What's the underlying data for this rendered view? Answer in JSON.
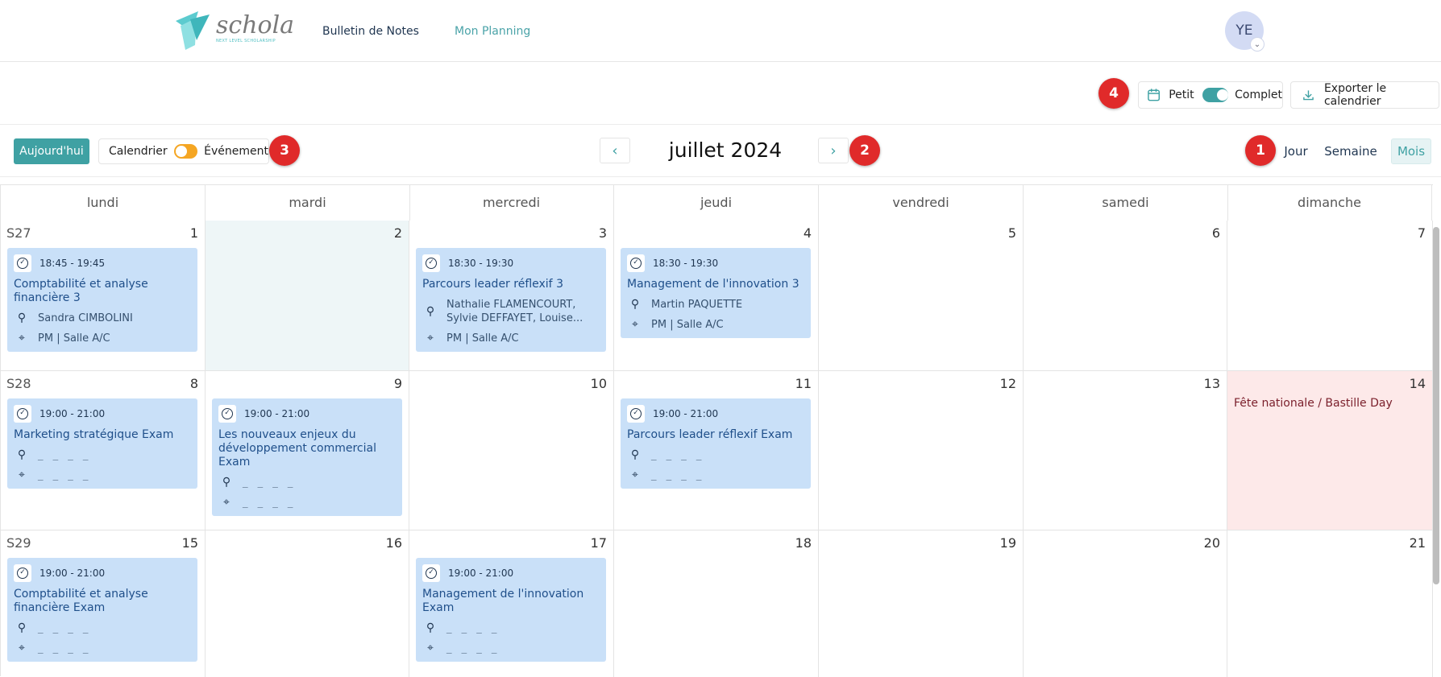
{
  "header": {
    "logo": {
      "text": "schola",
      "tagline": "NEXT LEVEL SCHOLARSHIP"
    },
    "nav": [
      {
        "label": "Bulletin de Notes",
        "active": false
      },
      {
        "label": "Mon Planning",
        "active": true
      }
    ],
    "avatar_initials": "YE",
    "avatar_chevron": "⌄"
  },
  "display": {
    "badge": "4",
    "size_small": "Petit",
    "size_full": "Complet",
    "size_toggle_on": true,
    "export_label": "Exporter le calendrier"
  },
  "toolbar": {
    "today_label": "Aujourd'hui",
    "mode_calendar": "Calendrier",
    "mode_event": "Événement",
    "mode_badge": "3",
    "prev_arrow": "‹",
    "next_arrow": "›",
    "nav_badge": "2",
    "month_title": "juillet 2024",
    "view_badge": "1",
    "views": [
      {
        "label": "Jour",
        "active": false
      },
      {
        "label": "Semaine",
        "active": false
      },
      {
        "label": "Mois",
        "active": true
      }
    ]
  },
  "calendar": {
    "weekdays": [
      "lundi",
      "mardi",
      "mercredi",
      "jeudi",
      "vendredi",
      "samedi",
      "dimanche"
    ],
    "weeks": [
      {
        "label": "S27",
        "days": [
          "1",
          "2",
          "3",
          "4",
          "5",
          "6",
          "7"
        ]
      },
      {
        "label": "S28",
        "days": [
          "8",
          "9",
          "10",
          "11",
          "12",
          "13",
          "14"
        ]
      },
      {
        "label": "S29",
        "days": [
          "15",
          "16",
          "17",
          "18",
          "19",
          "20",
          "21"
        ]
      }
    ],
    "holiday": "Fête nationale / Bastille Day",
    "placeholder": "_ _ _ _",
    "events": [
      {
        "time": "18:45 - 19:45",
        "title": "Comptabilité et analyse financière 3",
        "person": "Sandra CIMBOLINI",
        "location": "PM | Salle A/C"
      },
      {
        "time": "18:30 - 19:30",
        "title": "Parcours leader réflexif 3",
        "person": "Nathalie FLAMENCOURT, Sylvie DEFFAYET, Louise...",
        "location": "PM | Salle A/C"
      },
      {
        "time": "18:30 - 19:30",
        "title": "Management de l'innovation 3",
        "person": "Martin PAQUETTE",
        "location": "PM | Salle A/C"
      },
      {
        "time": "19:00 - 21:00",
        "title": "Marketing stratégique Exam"
      },
      {
        "time": "19:00 - 21:00",
        "title": "Les nouveaux enjeux du développement commercial Exam"
      },
      {
        "time": "19:00 - 21:00",
        "title": "Parcours leader réflexif Exam"
      },
      {
        "time": "19:00 - 21:00",
        "title": "Comptabilité et analyse financière Exam"
      },
      {
        "time": "19:00 - 21:00",
        "title": "Management de l'innovation Exam"
      }
    ]
  },
  "colors": {
    "accent": "#3fa1a3",
    "event_bg": "#c9e0f8",
    "holiday_bg": "#fde9e9",
    "today_bg": "#eef6f7",
    "badge_red": "#e02a2a",
    "mode_switch": "#f5a623"
  }
}
